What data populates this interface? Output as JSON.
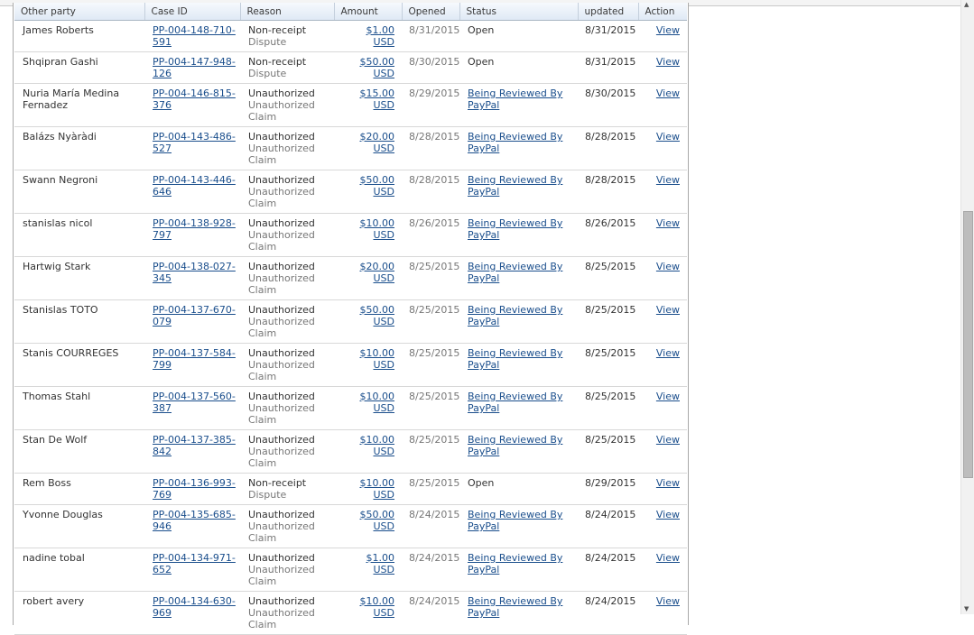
{
  "table": {
    "headers": {
      "other_party": "Other party",
      "case_id": "Case ID",
      "reason": "Reason",
      "amount": "Amount",
      "opened": "Opened",
      "status": "Status",
      "updated": "updated",
      "action": "Action"
    },
    "rows": [
      {
        "party": "James Roberts",
        "case_id": "PP-004-148-710-591",
        "reason": "Non-receipt",
        "reason_sub": "Dispute",
        "amount": "$1.00 USD",
        "opened": "8/31/2015",
        "status": "Open",
        "status_link": false,
        "updated": "8/31/2015",
        "action": "View"
      },
      {
        "party": "Shqipran Gashi",
        "case_id": "PP-004-147-948-126",
        "reason": "Non-receipt",
        "reason_sub": "Dispute",
        "amount": "$50.00 USD",
        "opened": "8/30/2015",
        "status": "Open",
        "status_link": false,
        "updated": "8/31/2015",
        "action": "View"
      },
      {
        "party": "Nuria María Medina Fernadez",
        "case_id": "PP-004-146-815-376",
        "reason": "Unauthorized",
        "reason_sub": "Unauthorized Claim",
        "amount": "$15.00 USD",
        "opened": "8/29/2015",
        "status": "Being Reviewed By PayPal",
        "status_link": true,
        "updated": "8/30/2015",
        "action": "View"
      },
      {
        "party": "Balázs Nyàràdi",
        "case_id": "PP-004-143-486-527",
        "reason": "Unauthorized",
        "reason_sub": "Unauthorized Claim",
        "amount": "$20.00 USD",
        "opened": "8/28/2015",
        "status": "Being Reviewed By PayPal",
        "status_link": true,
        "updated": "8/28/2015",
        "action": "View"
      },
      {
        "party": "Swann Negroni",
        "case_id": "PP-004-143-446-646",
        "reason": "Unauthorized",
        "reason_sub": "Unauthorized Claim",
        "amount": "$50.00 USD",
        "opened": "8/28/2015",
        "status": "Being Reviewed By PayPal",
        "status_link": true,
        "updated": "8/28/2015",
        "action": "View"
      },
      {
        "party": "stanislas nicol",
        "case_id": "PP-004-138-928-797",
        "reason": "Unauthorized",
        "reason_sub": "Unauthorized Claim",
        "amount": "$10.00 USD",
        "opened": "8/26/2015",
        "status": "Being Reviewed By PayPal",
        "status_link": true,
        "updated": "8/26/2015",
        "action": "View"
      },
      {
        "party": "Hartwig Stark",
        "case_id": "PP-004-138-027-345",
        "reason": "Unauthorized",
        "reason_sub": "Unauthorized Claim",
        "amount": "$20.00 USD",
        "opened": "8/25/2015",
        "status": "Being Reviewed By PayPal",
        "status_link": true,
        "updated": "8/25/2015",
        "action": "View"
      },
      {
        "party": "Stanislas TOTO",
        "case_id": "PP-004-137-670-079",
        "reason": "Unauthorized",
        "reason_sub": "Unauthorized Claim",
        "amount": "$50.00 USD",
        "opened": "8/25/2015",
        "status": "Being Reviewed By PayPal",
        "status_link": true,
        "updated": "8/25/2015",
        "action": "View"
      },
      {
        "party": "Stanis COURREGES",
        "case_id": "PP-004-137-584-799",
        "reason": "Unauthorized",
        "reason_sub": "Unauthorized Claim",
        "amount": "$10.00 USD",
        "opened": "8/25/2015",
        "status": "Being Reviewed By PayPal",
        "status_link": true,
        "updated": "8/25/2015",
        "action": "View"
      },
      {
        "party": "Thomas Stahl",
        "case_id": "PP-004-137-560-387",
        "reason": "Unauthorized",
        "reason_sub": "Unauthorized Claim",
        "amount": "$10.00 USD",
        "opened": "8/25/2015",
        "status": "Being Reviewed By PayPal",
        "status_link": true,
        "updated": "8/25/2015",
        "action": "View"
      },
      {
        "party": "Stan De Wolf",
        "case_id": "PP-004-137-385-842",
        "reason": "Unauthorized",
        "reason_sub": "Unauthorized Claim",
        "amount": "$10.00 USD",
        "opened": "8/25/2015",
        "status": "Being Reviewed By PayPal",
        "status_link": true,
        "updated": "8/25/2015",
        "action": "View"
      },
      {
        "party": "Rem Boss",
        "case_id": "PP-004-136-993-769",
        "reason": "Non-receipt",
        "reason_sub": "Dispute",
        "amount": "$10.00 USD",
        "opened": "8/25/2015",
        "status": "Open",
        "status_link": false,
        "updated": "8/29/2015",
        "action": "View"
      },
      {
        "party": "Yvonne Douglas",
        "case_id": "PP-004-135-685-946",
        "reason": "Unauthorized",
        "reason_sub": "Unauthorized Claim",
        "amount": "$50.00 USD",
        "opened": "8/24/2015",
        "status": "Being Reviewed By PayPal",
        "status_link": true,
        "updated": "8/24/2015",
        "action": "View"
      },
      {
        "party": "nadine tobal",
        "case_id": "PP-004-134-971-652",
        "reason": "Unauthorized",
        "reason_sub": "Unauthorized Claim",
        "amount": "$1.00 USD",
        "opened": "8/24/2015",
        "status": "Being Reviewed By PayPal",
        "status_link": true,
        "updated": "8/24/2015",
        "action": "View"
      },
      {
        "party": "robert avery",
        "case_id": "PP-004-134-630-969",
        "reason": "Unauthorized",
        "reason_sub": "Unauthorized Claim",
        "amount": "$10.00 USD",
        "opened": "8/24/2015",
        "status": "Being Reviewed By PayPal",
        "status_link": true,
        "updated": "8/24/2015",
        "action": "View"
      }
    ]
  },
  "scrollbar": {
    "up_icon": "arrow-up-icon",
    "down_icon": "arrow-down-icon",
    "position": 0.52,
    "visible_fraction": 0.43
  },
  "colors": {
    "link": "#1a4e8c",
    "header_bg": "#dfe9f5",
    "muted_text": "#777777"
  }
}
